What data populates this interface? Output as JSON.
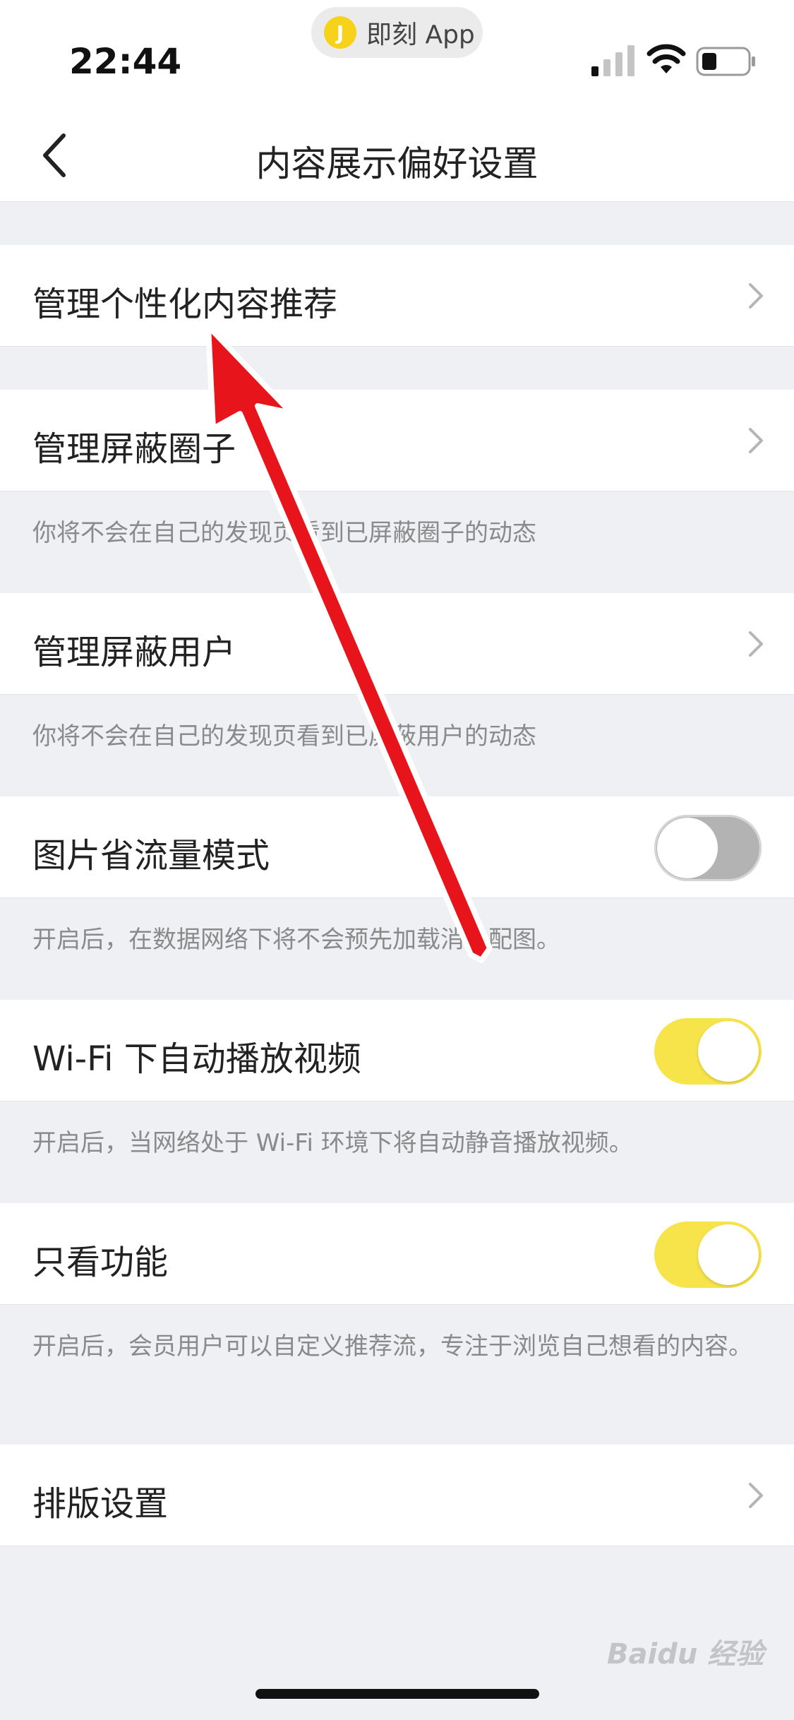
{
  "status_bar": {
    "time": "22:44",
    "app_pill_logo": "J",
    "app_pill_label": "即刻 App",
    "icons": [
      "signal-icon",
      "wifi-icon",
      "battery-icon"
    ]
  },
  "nav": {
    "title": "内容展示偏好设置",
    "back_icon": "chevron-left-icon"
  },
  "settings": [
    {
      "label": "管理个性化内容推荐",
      "control": "chevron"
    },
    {
      "label": "管理屏蔽圈子",
      "control": "chevron",
      "description": "你将不会在自己的发现页看到已屏蔽圈子的动态"
    },
    {
      "label": "管理屏蔽用户",
      "control": "chevron",
      "description": "你将不会在自己的发现页看到已屏蔽用户的动态"
    },
    {
      "label": "图片省流量模式",
      "control": "toggle",
      "toggle_on": false,
      "description": "开启后，在数据网络下将不会预先加载消息配图。"
    },
    {
      "label": "Wi-Fi 下自动播放视频",
      "control": "toggle",
      "toggle_on": true,
      "description": "开启后，当网络处于 Wi-Fi 环境下将自动静音播放视频。"
    },
    {
      "label": "只看功能",
      "control": "toggle",
      "toggle_on": true,
      "description": "开启后，会员用户可以自定义推荐流，专注于浏览自己想看的内容。"
    },
    {
      "label": "排版设置",
      "control": "chevron"
    }
  ],
  "colors": {
    "toggle_on": "#f7e34a",
    "toggle_off": "#b3b3b3",
    "annotation_arrow": "#e8141b",
    "background": "#eef0f3"
  },
  "watermark": "Baidu 经验"
}
